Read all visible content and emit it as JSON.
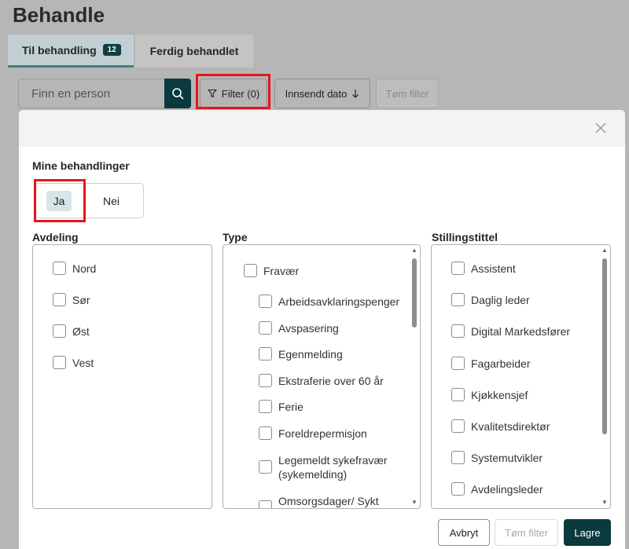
{
  "page": {
    "title": "Behandle"
  },
  "tabs": [
    {
      "label": "Til behandling",
      "badge": "12"
    },
    {
      "label": "Ferdig behandlet"
    }
  ],
  "toolbar": {
    "search_placeholder": "Finn en person",
    "filter_label": "Filter (0)",
    "sort_label": "Innsendt dato",
    "clear_label": "Tøm filter"
  },
  "modal": {
    "my_treatments_label": "Mine behandlinger",
    "toggle_yes": "Ja",
    "toggle_no": "Nei",
    "department": {
      "label": "Avdeling",
      "items": [
        "Nord",
        "Sør",
        "Øst",
        "Vest"
      ]
    },
    "type": {
      "label": "Type",
      "parent": "Fravær",
      "items": [
        "Arbeidsavklaringspenger",
        "Avspasering",
        "Egenmelding",
        "Ekstraferie over 60 år",
        "Ferie",
        "Foreldrepermisjon",
        "Legemeldt sykefravær (sykemelding)",
        "Omsorgsdager/ Sykt"
      ]
    },
    "job_title": {
      "label": "Stillingstittel",
      "items": [
        "Assistent",
        "Daglig leder",
        "Digital Markedsfører",
        "Fagarbeider",
        "Kjøkkensjef",
        "Kvalitetsdirektør",
        "Systemutvikler",
        "Avdelingsleder"
      ]
    },
    "footer": {
      "cancel_label": "Avbryt",
      "clear_label": "Tøm filter",
      "save_label": "Lagre"
    }
  },
  "colors": {
    "accent": "#0b3a3e",
    "highlight": "#e3161d"
  }
}
